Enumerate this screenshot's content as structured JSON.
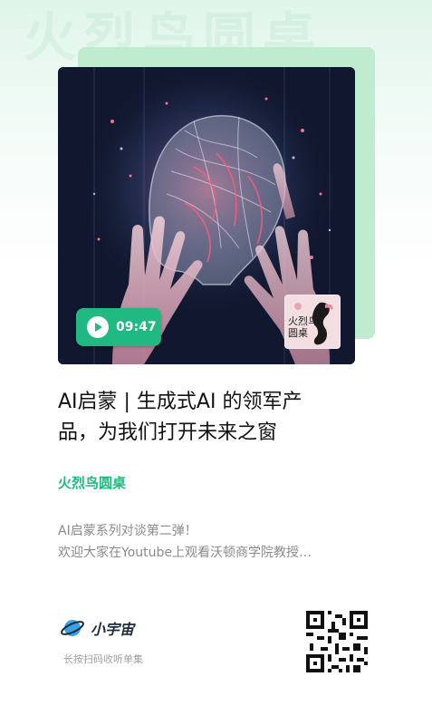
{
  "watermark": "火烈鸟圆桌",
  "cover": {
    "duration": "09:47",
    "badge_text": "火烈鸟圆桌"
  },
  "title": {
    "line1": "AI启蒙 | 生成式AI 的领军产",
    "line2": "品，为我们打开未来之窗"
  },
  "author": "火烈鸟圆桌",
  "description": {
    "line1": "AI启蒙系列对谈第二弹！",
    "line2": "欢迎大家在Youtube上观看沃顿商学院教授…"
  },
  "footer": {
    "brand_name": "小宇宙",
    "hint": "长按扫码收听单集"
  },
  "colors": {
    "accent": "#1fb981",
    "cover_back": "#bfeccf"
  }
}
